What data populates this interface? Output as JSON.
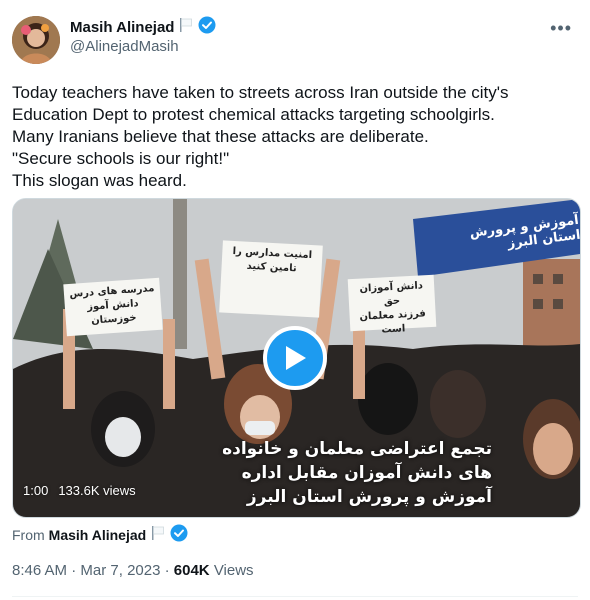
{
  "author": {
    "name": "Masih Alinejad",
    "handle": "@AlinejadMasih"
  },
  "colors": {
    "verified": "#1d9bf0",
    "muted": "#536471",
    "text": "#0f1419",
    "play": "#1d9bf0"
  },
  "icons": {
    "more": "more-icon",
    "verified": "verified-badge-icon",
    "flag": "white-flag-icon",
    "play": "play-icon"
  },
  "tweet": {
    "lines": [
      "Today teachers have taken to streets across Iran outside the city's",
      "Education Dept to protest chemical attacks targeting schoolgirls.",
      "Many Iranians believe that these attacks are deliberate.",
      "\"Secure schools is our right!\"",
      "This slogan was heard."
    ]
  },
  "video": {
    "duration": "1:00",
    "views": "133.6K views",
    "caption_lines": [
      "تجمع اعتراضی معلمان و خانواده",
      "های دانش آموزان مقابل اداره",
      "آموزش و پرورش استان البرز"
    ],
    "banner_text": "آموزش و پرورش استان البرز",
    "signs": {
      "center": [
        "امنیت مدارس را",
        "تامین کنید"
      ],
      "left": [
        "مدرسه های درس",
        "دانش آموز خوزستان"
      ],
      "right": [
        "دانش آموزان حق",
        "فرزند معلمان است"
      ]
    }
  },
  "from": {
    "label": "From",
    "name": "Masih Alinejad"
  },
  "meta": {
    "time": "8:46 AM",
    "separator": "·",
    "date": "Mar 7, 2023",
    "views_count": "604K",
    "views_label": "Views"
  }
}
